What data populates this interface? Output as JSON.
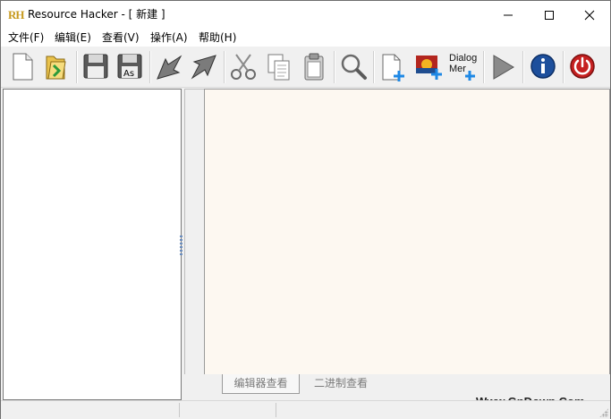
{
  "window": {
    "logo_text": "RH",
    "title": "Resource Hacker - [ 新建 ]"
  },
  "menu": {
    "items": [
      "文件(F)",
      "编辑(E)",
      "查看(V)",
      "操作(A)",
      "帮助(H)"
    ]
  },
  "toolbar": {
    "dialog_label_line1": "Dialog",
    "dialog_label_line2": "Mer",
    "icons": [
      "new-file-icon",
      "open-folder-icon",
      "save-icon",
      "save-as-icon",
      "import-icon",
      "export-icon",
      "cut-icon",
      "copy-icon",
      "paste-icon",
      "find-icon",
      "add-resource-icon",
      "add-image-icon",
      "dialog-merge-icon",
      "run-icon",
      "info-icon",
      "power-icon"
    ]
  },
  "tabs": {
    "editor_view": "编辑器查看",
    "binary_view": "二进制查看"
  },
  "watermark": "Www.GnDown.Com",
  "colors": {
    "editor_bg": "#fdf8f1",
    "accent_blue": "#1d4f9c",
    "power_red": "#c62020"
  }
}
